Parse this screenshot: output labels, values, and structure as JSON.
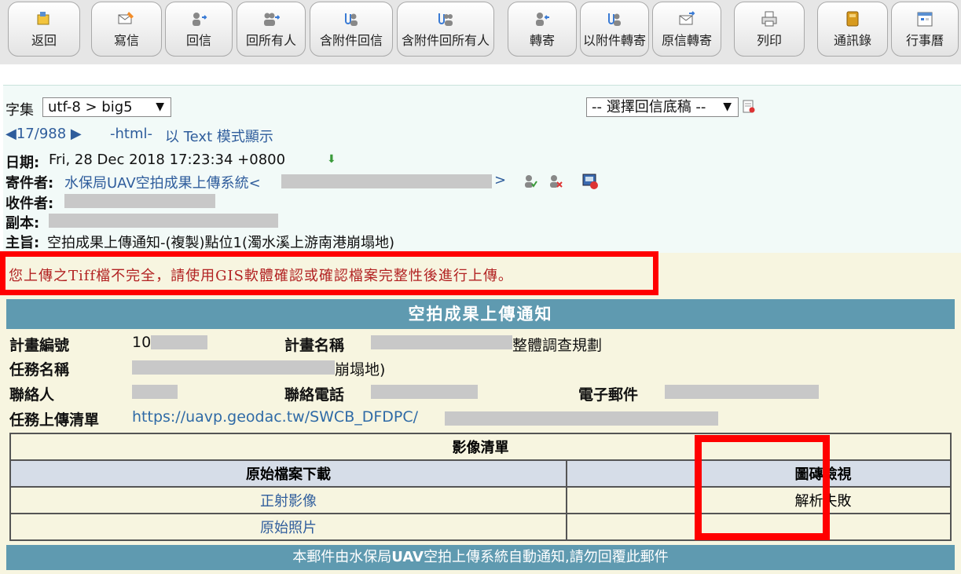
{
  "toolbar": {
    "buttons": [
      {
        "label": "返回"
      },
      {
        "label": "寫信"
      },
      {
        "label": "回信"
      },
      {
        "label": "回所有人"
      },
      {
        "label": "含附件回信"
      },
      {
        "label": "含附件回所有人"
      },
      {
        "label": "轉寄"
      },
      {
        "label": "以附件轉寄"
      },
      {
        "label": "原信轉寄"
      },
      {
        "label": "列印"
      },
      {
        "label": "通訊錄"
      },
      {
        "label": "行事曆"
      }
    ]
  },
  "header": {
    "charset_label": "字集",
    "charset_value": "utf-8 > big5",
    "reply_template": "-- 選擇回信底稿 --",
    "nav_position": "17/988",
    "html_label": "-html-",
    "text_mode": "以 Text 模式顯示",
    "date_label": "日期:",
    "date_value": "Fri, 28 Dec 2018 17:23:34 +0800",
    "from_label": "寄件者:",
    "from_name": "水保局UAV空拍成果上傳系統<",
    "from_close": ">",
    "to_label": "收件者:",
    "cc_label": "副本:",
    "subject_label": "主旨:",
    "subject_value": "空拍成果上傳通知-(複製)點位1(濁水溪上游南港崩塌地)"
  },
  "alert": {
    "message": "您上傳之Tiff檔不完全，請使用GIS軟體確認或確認檔案完整性後進行上傳。"
  },
  "notice": {
    "title": "空拍成果上傳通知",
    "plan_no_label": "計畫編號",
    "plan_no_value": "10",
    "plan_name_label": "計畫名稱",
    "plan_name_value": "整體調查規劃",
    "task_name_label": "任務名稱",
    "task_name_value": "崩塌地)",
    "contact_label": "聯絡人",
    "phone_label": "聯絡電話",
    "email_label": "電子郵件",
    "upload_list_label": "任務上傳清單",
    "upload_list_url": "https://uavp.geodac.tw/SWCB_DFDPC/"
  },
  "image_table": {
    "caption": "影像清單",
    "col_download": "原始檔案下載",
    "col_tile_view": "圖磚檢視",
    "rows": [
      {
        "name": "正射影像",
        "status": "解析失敗"
      },
      {
        "name": "原始照片",
        "status": ""
      }
    ]
  },
  "footer": {
    "text_prefix": "本郵件由水保局",
    "text_bold": "UAV",
    "text_suffix": "空拍上傳系統自動通知,請勿回覆此郵件"
  }
}
